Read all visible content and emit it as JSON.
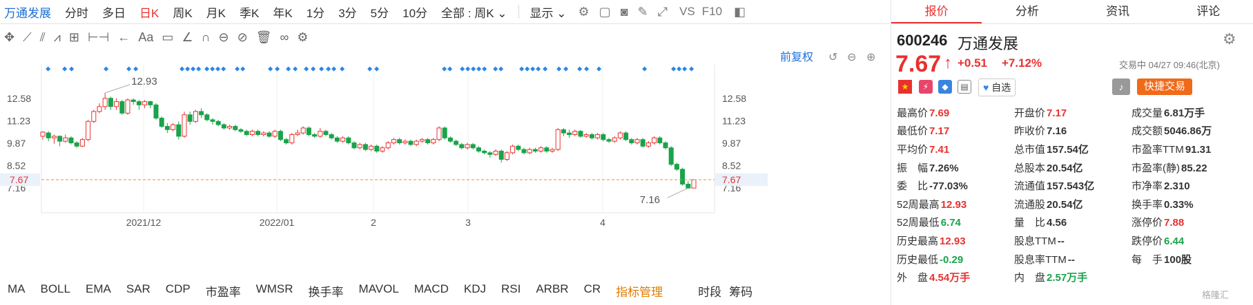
{
  "topbar": {
    "stock_name": "万通发展",
    "periods": [
      "分时",
      "多日",
      "日K",
      "周K",
      "月K",
      "季K",
      "年K",
      "1分",
      "3分",
      "5分",
      "10分"
    ],
    "active_period": "日K",
    "filter": "全部 : 周K",
    "display": "显示",
    "vs": "VS",
    "f10": "F10"
  },
  "toolbar": {
    "text_tool": "Aa"
  },
  "chart": {
    "fq_label": "前复权",
    "y_ticks": [
      "12.58",
      "11.23",
      "9.87",
      "8.52",
      "7.16"
    ],
    "current_price_label": "7.67",
    "x_ticks": [
      "2021/12",
      "2022/01",
      "2",
      "3",
      "4"
    ],
    "high_annotation": "12.93",
    "low_annotation": "7.16"
  },
  "chart_data": {
    "type": "candlestick",
    "ylim": [
      6.5,
      13.8
    ],
    "y_ticks": [
      12.58,
      11.23,
      9.87,
      8.52,
      7.16
    ],
    "current_price": 7.67,
    "max": 12.93,
    "min": 7.16,
    "candles": [
      [
        10.3,
        10.55,
        10.6,
        10.1
      ],
      [
        10.5,
        10.2,
        10.6,
        10.0
      ],
      [
        10.2,
        10.3,
        10.4,
        9.85
      ],
      [
        10.3,
        10.0,
        10.35,
        9.7
      ],
      [
        10.0,
        10.2,
        10.4,
        9.9
      ],
      [
        10.2,
        9.9,
        10.3,
        9.8
      ],
      [
        9.9,
        9.7,
        10.0,
        9.6
      ],
      [
        9.7,
        10.1,
        10.2,
        9.65
      ],
      [
        10.1,
        11.2,
        11.3,
        10.0
      ],
      [
        11.2,
        11.8,
        11.9,
        11.1
      ],
      [
        11.8,
        12.1,
        12.3,
        11.7
      ],
      [
        12.1,
        12.6,
        12.93,
        11.9
      ],
      [
        12.6,
        12.1,
        12.7,
        11.9
      ],
      [
        12.1,
        12.4,
        12.6,
        11.9
      ],
      [
        12.4,
        11.7,
        12.5,
        11.6
      ],
      [
        11.7,
        12.5,
        12.6,
        11.6
      ],
      [
        12.5,
        12.4,
        12.6,
        12.2
      ],
      [
        12.4,
        12.2,
        12.5,
        11.9
      ],
      [
        12.2,
        12.4,
        12.5,
        12.0
      ],
      [
        12.4,
        12.2,
        12.45,
        12.0
      ],
      [
        12.2,
        11.4,
        12.3,
        11.3
      ],
      [
        11.4,
        10.9,
        11.5,
        10.8
      ],
      [
        10.9,
        10.7,
        11.1,
        10.5
      ],
      [
        10.7,
        11.0,
        11.1,
        10.6
      ],
      [
        11.0,
        10.3,
        11.2,
        10.1
      ],
      [
        10.3,
        11.6,
        11.8,
        10.2
      ],
      [
        11.6,
        11.2,
        11.8,
        11.0
      ],
      [
        11.2,
        11.8,
        11.9,
        11.1
      ],
      [
        11.8,
        11.6,
        12.0,
        11.4
      ],
      [
        11.6,
        11.3,
        11.7,
        11.2
      ],
      [
        11.3,
        11.2,
        11.4,
        11.0
      ],
      [
        11.2,
        11.0,
        11.3,
        10.9
      ],
      [
        11.0,
        10.8,
        11.1,
        10.7
      ],
      [
        10.8,
        10.9,
        11.0,
        10.7
      ],
      [
        10.9,
        10.7,
        11.0,
        10.6
      ],
      [
        10.7,
        10.6,
        10.8,
        10.5
      ],
      [
        10.6,
        10.4,
        10.7,
        10.3
      ],
      [
        10.4,
        10.6,
        10.7,
        10.3
      ],
      [
        10.6,
        10.4,
        10.7,
        10.3
      ],
      [
        10.4,
        10.5,
        10.6,
        10.3
      ],
      [
        10.5,
        10.3,
        10.6,
        10.2
      ],
      [
        10.3,
        10.6,
        10.7,
        10.2
      ],
      [
        10.6,
        10.1,
        10.7,
        10.0
      ],
      [
        10.1,
        9.9,
        10.2,
        9.8
      ],
      [
        9.9,
        10.4,
        10.5,
        9.8
      ],
      [
        10.4,
        10.5,
        10.7,
        10.3
      ],
      [
        10.5,
        10.8,
        10.9,
        10.4
      ],
      [
        10.8,
        10.4,
        10.9,
        10.3
      ],
      [
        10.4,
        10.3,
        10.5,
        10.2
      ],
      [
        10.3,
        10.6,
        10.8,
        10.2
      ],
      [
        10.6,
        10.4,
        10.7,
        10.3
      ],
      [
        10.4,
        10.2,
        10.5,
        10.1
      ],
      [
        10.2,
        10.0,
        10.3,
        9.9
      ],
      [
        10.0,
        10.2,
        10.3,
        9.9
      ],
      [
        10.2,
        9.9,
        10.3,
        9.8
      ],
      [
        9.9,
        9.6,
        10.0,
        9.5
      ],
      [
        9.6,
        9.8,
        9.9,
        9.5
      ],
      [
        9.8,
        9.5,
        9.9,
        9.4
      ],
      [
        9.5,
        9.7,
        9.8,
        9.4
      ],
      [
        9.7,
        9.4,
        9.8,
        9.3
      ],
      [
        9.4,
        9.6,
        9.7,
        9.3
      ],
      [
        9.6,
        9.9,
        10.0,
        9.5
      ],
      [
        9.9,
        10.1,
        10.2,
        9.8
      ],
      [
        10.1,
        9.9,
        10.2,
        9.8
      ],
      [
        9.9,
        10.0,
        10.1,
        9.8
      ],
      [
        10.0,
        9.8,
        10.1,
        9.7
      ],
      [
        9.8,
        10.0,
        10.1,
        9.7
      ],
      [
        10.0,
        10.1,
        10.2,
        9.9
      ],
      [
        10.1,
        9.9,
        10.2,
        9.8
      ],
      [
        9.9,
        10.1,
        10.2,
        9.8
      ],
      [
        10.1,
        10.8,
        10.9,
        10.0
      ],
      [
        10.8,
        10.2,
        10.9,
        10.1
      ],
      [
        10.2,
        10.0,
        10.3,
        9.9
      ],
      [
        10.0,
        9.8,
        10.1,
        9.7
      ],
      [
        9.8,
        9.6,
        9.9,
        9.5
      ],
      [
        9.6,
        9.8,
        9.9,
        9.5
      ],
      [
        9.8,
        9.6,
        9.9,
        9.5
      ],
      [
        9.6,
        9.4,
        9.7,
        9.3
      ],
      [
        9.4,
        9.3,
        9.5,
        9.2
      ],
      [
        9.3,
        9.2,
        9.4,
        9.0
      ],
      [
        9.2,
        9.4,
        9.5,
        9.1
      ],
      [
        9.4,
        8.9,
        9.5,
        8.7
      ],
      [
        8.9,
        9.3,
        9.4,
        8.8
      ],
      [
        9.3,
        9.7,
        9.8,
        9.2
      ],
      [
        9.7,
        9.5,
        9.8,
        9.4
      ],
      [
        9.5,
        9.3,
        9.6,
        9.2
      ],
      [
        9.3,
        9.5,
        9.6,
        9.2
      ],
      [
        9.5,
        9.4,
        9.6,
        9.3
      ],
      [
        9.4,
        9.6,
        9.7,
        9.3
      ],
      [
        9.6,
        9.4,
        9.7,
        9.3
      ],
      [
        9.4,
        9.5,
        9.6,
        9.3
      ],
      [
        9.5,
        10.7,
        10.8,
        9.4
      ],
      [
        10.7,
        10.5,
        10.8,
        10.3
      ],
      [
        10.5,
        10.4,
        10.7,
        10.2
      ],
      [
        10.4,
        10.6,
        10.7,
        10.3
      ],
      [
        10.6,
        10.3,
        10.7,
        10.2
      ],
      [
        10.3,
        10.4,
        10.5,
        10.2
      ],
      [
        10.4,
        10.2,
        10.5,
        10.1
      ],
      [
        10.2,
        10.4,
        10.5,
        10.1
      ],
      [
        10.4,
        10.1,
        10.5,
        10.0
      ],
      [
        10.1,
        10.0,
        10.2,
        9.9
      ],
      [
        10.0,
        10.2,
        10.3,
        9.9
      ],
      [
        10.2,
        10.5,
        10.6,
        10.1
      ],
      [
        10.5,
        10.1,
        10.6,
        10.0
      ],
      [
        10.1,
        9.9,
        10.2,
        9.8
      ],
      [
        9.9,
        10.1,
        10.2,
        9.8
      ],
      [
        10.1,
        9.7,
        10.2,
        9.6
      ],
      [
        9.7,
        9.9,
        10.0,
        9.6
      ],
      [
        9.9,
        10.2,
        10.3,
        9.8
      ],
      [
        10.2,
        9.9,
        10.3,
        9.8
      ],
      [
        9.9,
        9.6,
        10.0,
        9.5
      ],
      [
        9.6,
        8.6,
        9.7,
        8.5
      ],
      [
        8.6,
        8.3,
        8.7,
        8.2
      ],
      [
        8.3,
        7.4,
        8.4,
        7.3
      ],
      [
        7.4,
        7.16,
        7.6,
        7.16
      ],
      [
        7.16,
        7.67,
        7.69,
        7.16
      ]
    ]
  },
  "indicators": {
    "items": [
      "MA",
      "BOLL",
      "EMA",
      "SAR",
      "CDP",
      "市盈率",
      "WMSR",
      "换手率",
      "MAVOL",
      "MACD",
      "KDJ",
      "RSI",
      "ARBR",
      "CR"
    ],
    "manage": "指标管理",
    "period": "时段",
    "chips": "筹码"
  },
  "right": {
    "tabs": [
      "报价",
      "分析",
      "资讯",
      "评论"
    ],
    "code": "600246",
    "name": "万通发展",
    "price": "7.67",
    "change": "+0.51",
    "change_pct": "+7.12%",
    "status": "交易中 04/27 09:46(北京)",
    "watch": "自选",
    "quick_trade": "快捷交易",
    "rows": [
      [
        [
          "最高价",
          "7.69",
          "red"
        ],
        [
          "开盘价",
          "7.17",
          "red"
        ],
        [
          "成交量",
          "6.81万手",
          ""
        ]
      ],
      [
        [
          "最低价",
          "7.17",
          "red"
        ],
        [
          "昨收价",
          "7.16",
          ""
        ],
        [
          "成交额",
          "5046.86万",
          ""
        ]
      ],
      [
        [
          "平均价",
          "7.41",
          "red"
        ],
        [
          "总市值",
          "157.54亿",
          ""
        ],
        [
          "市盈率TTM",
          "91.31",
          ""
        ]
      ],
      [
        [
          "振　幅",
          "7.26%",
          ""
        ],
        [
          "总股本",
          "20.54亿",
          ""
        ],
        [
          "市盈率(静)",
          "85.22",
          ""
        ]
      ],
      [
        [
          "委　比",
          "-77.03%",
          ""
        ],
        [
          "流通值",
          "157.543亿",
          ""
        ],
        [
          "市净率",
          "2.310",
          ""
        ]
      ],
      [
        [
          "52周最高",
          "12.93",
          "red"
        ],
        [
          "流通股",
          "20.54亿",
          ""
        ],
        [
          "换手率",
          "0.33%",
          ""
        ]
      ],
      [
        [
          "52周最低",
          "6.74",
          "green"
        ],
        [
          "量　比",
          "4.56",
          ""
        ],
        [
          "涨停价",
          "7.88",
          "red"
        ]
      ],
      [
        [
          "历史最高",
          "12.93",
          "red"
        ],
        [
          "股息TTM",
          "--",
          ""
        ],
        [
          "跌停价",
          "6.44",
          "green"
        ]
      ],
      [
        [
          "历史最低",
          "-0.29",
          "green"
        ],
        [
          "股息率TTM",
          "--",
          ""
        ],
        [
          "每　手",
          "100股",
          ""
        ]
      ],
      [
        [
          "外　盘",
          "4.54万手",
          "red"
        ],
        [
          "内　盘",
          "2.57万手",
          "green"
        ],
        [
          "",
          "",
          ""
        ]
      ]
    ],
    "watermark": "格隆汇"
  }
}
